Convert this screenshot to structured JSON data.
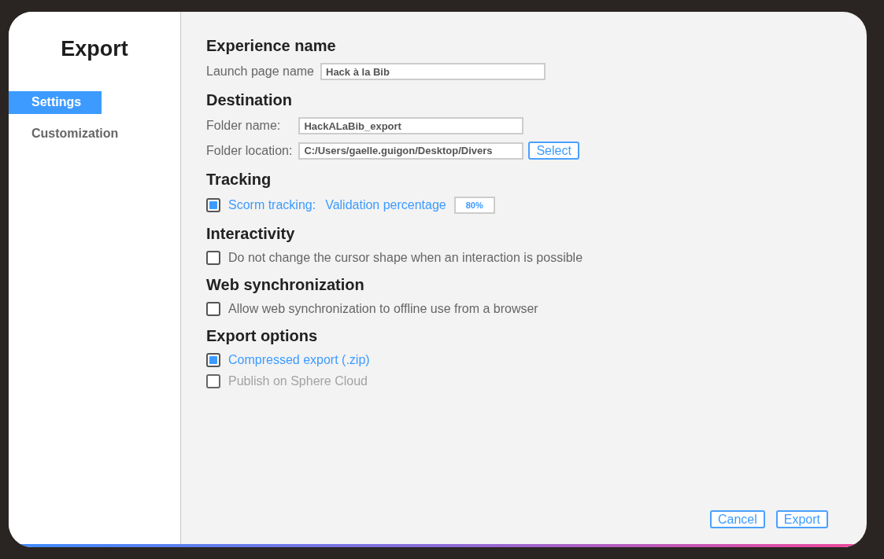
{
  "dialog": {
    "title": "Export"
  },
  "sidebar": {
    "items": [
      {
        "label": "Settings",
        "selected": true
      },
      {
        "label": "Customization",
        "selected": false
      }
    ]
  },
  "sections": [
    {
      "heading": "Experience name",
      "rows": [
        {
          "kind": "field",
          "label": "Launch page name",
          "value": "Hack à la Bib"
        }
      ]
    },
    {
      "heading": "Destination",
      "rows": [
        {
          "kind": "field",
          "label": "Folder name:",
          "value": "HackALaBib_export"
        },
        {
          "kind": "field",
          "label": "Folder location:",
          "value": "C:/Users/gaelle.guigon/Desktop/Divers",
          "button": "Select"
        }
      ]
    },
    {
      "heading": "Tracking",
      "rows": [
        {
          "kind": "checkbox",
          "label": "Scorm tracking:",
          "checked": true,
          "disabled": false,
          "extra_label": "Validation percentage",
          "extra_value": "80%"
        }
      ]
    },
    {
      "heading": "Interactivity",
      "rows": [
        {
          "kind": "checkbox",
          "label": "Do not change the cursor shape when an interaction is possible",
          "checked": false,
          "disabled": false
        }
      ]
    },
    {
      "heading": "Web synchronization",
      "rows": [
        {
          "kind": "checkbox",
          "label": "Allow web synchronization to offline use from a browser",
          "checked": false,
          "disabled": false
        }
      ]
    },
    {
      "heading": "Export options",
      "rows": [
        {
          "kind": "checkbox",
          "label": "Compressed export (.zip)",
          "checked": true,
          "disabled": false
        },
        {
          "kind": "checkbox",
          "label": "Publish on Sphere Cloud",
          "checked": false,
          "disabled": true
        }
      ]
    }
  ],
  "buttons": [
    "Cancel",
    "Export"
  ]
}
